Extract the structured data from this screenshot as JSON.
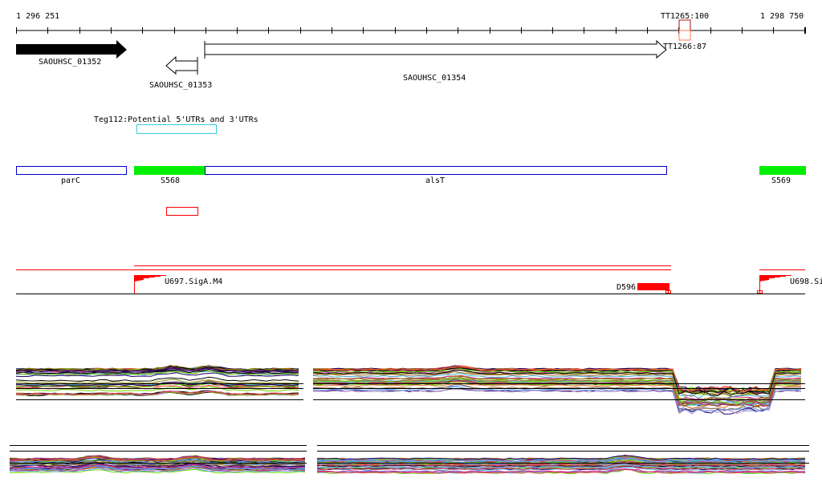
{
  "ruler": {
    "start_label": "1 296 251",
    "end_label": "1 298 750"
  },
  "terminators": [
    {
      "label": "TT1265:100"
    },
    {
      "label": "TT1266:87"
    }
  ],
  "genes": [
    {
      "label": "SAOUHSC_01352",
      "strand": "+"
    },
    {
      "label": "SAOUHSC_01353",
      "strand": "-"
    },
    {
      "label": "SAOUHSC_01354",
      "strand": "+"
    }
  ],
  "utr_track": {
    "label": "Teg112:Potential 5'UTRs and 3'UTRs",
    "color": "#33ccdd"
  },
  "operons": [
    {
      "label": "parC",
      "type": "outline",
      "color": "#0000cc"
    },
    {
      "label": "S568",
      "type": "filled",
      "color": "#00ee00"
    },
    {
      "label": "alsT",
      "type": "outline",
      "color": "#0000cc"
    },
    {
      "label": "S569",
      "type": "filled",
      "color": "#00ee00"
    }
  ],
  "transcripts": [
    {
      "label": "U697.SigA.M4",
      "kind": "promoter"
    },
    {
      "label": "D596",
      "kind": "downshift"
    },
    {
      "label": "U698.Si",
      "kind": "promoter"
    }
  ],
  "colors": {
    "red": "#ff0000",
    "terminator_dark": "#aa1111",
    "terminator_light": "#ff7755"
  },
  "trace_palette": [
    "#000000",
    "#8b8b00",
    "#e07020",
    "#66dd00",
    "#cc2288",
    "#6699ee",
    "#aa4444",
    "#bb99cc",
    "#44aacc",
    "#ee4444",
    "#996633",
    "#220066"
  ]
}
